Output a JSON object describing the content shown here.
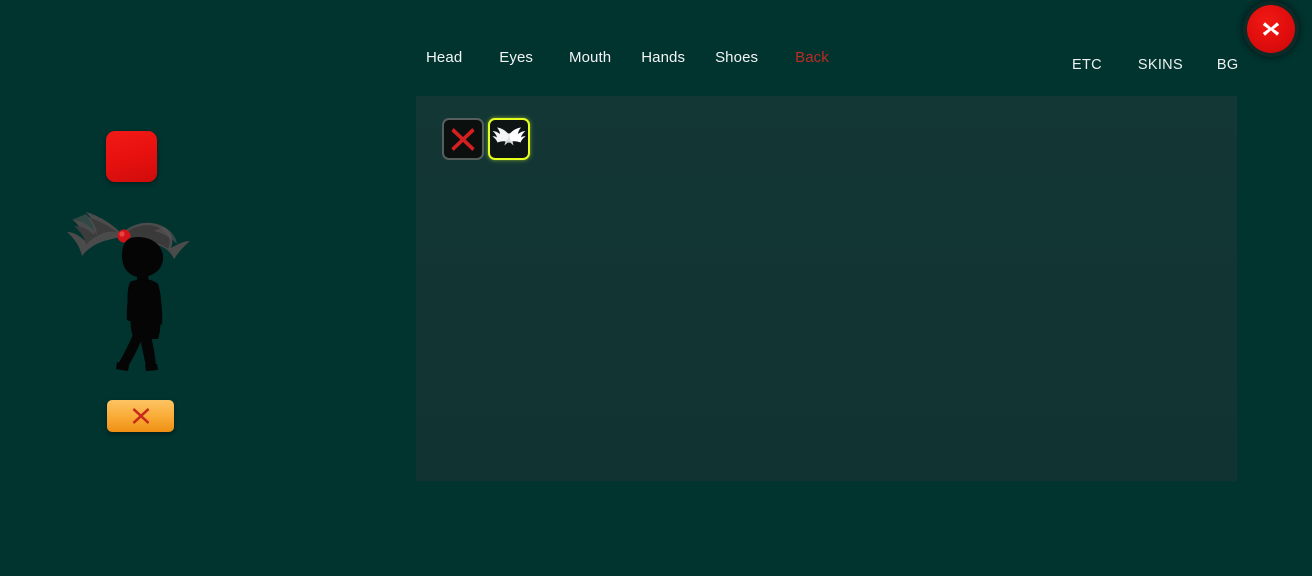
{
  "window": {
    "background_color": "#01332F",
    "panel_color": "#123634"
  },
  "close_button": {
    "icon": "close-x-icon",
    "label": "X",
    "color": "#E00D0D"
  },
  "top_nav": {
    "items": [
      {
        "label": "Head",
        "active": false,
        "color": "#F2F5F4"
      },
      {
        "label": "Eyes",
        "active": false,
        "color": "#F2F5F4"
      },
      {
        "label": "Mouth",
        "active": false,
        "color": "#F2F5F4"
      },
      {
        "label": "Hands",
        "active": false,
        "color": "#F2F5F4"
      },
      {
        "label": "Shoes",
        "active": false,
        "color": "#F2F5F4"
      },
      {
        "label": "Back",
        "active": true,
        "color": "#BB2D25"
      }
    ]
  },
  "right_nav": {
    "items": [
      {
        "label": "ETC",
        "color": "#EEF3F2"
      },
      {
        "label": "SKINS",
        "color": "#EEF3F2"
      },
      {
        "label": "BG",
        "color": "#EEF3F2"
      }
    ]
  },
  "item_panel": {
    "category": "Back",
    "slots": [
      {
        "name": "none",
        "icon": "red-x-icon",
        "selected": false
      },
      {
        "name": "angel-wings",
        "icon": "white-wings-icon",
        "selected": true
      }
    ]
  },
  "preview": {
    "color_swatch": {
      "name": "color-swatch",
      "color": "#E8110F"
    },
    "character": {
      "body_color": "#050505",
      "hair_color": "#4A4A4A",
      "accent_color": "#D0141A",
      "description": "stick figure with spiky gray ponytail"
    },
    "action_button": {
      "name": "clear-button",
      "icon": "red-x-icon",
      "color": "#F9AA34"
    }
  }
}
